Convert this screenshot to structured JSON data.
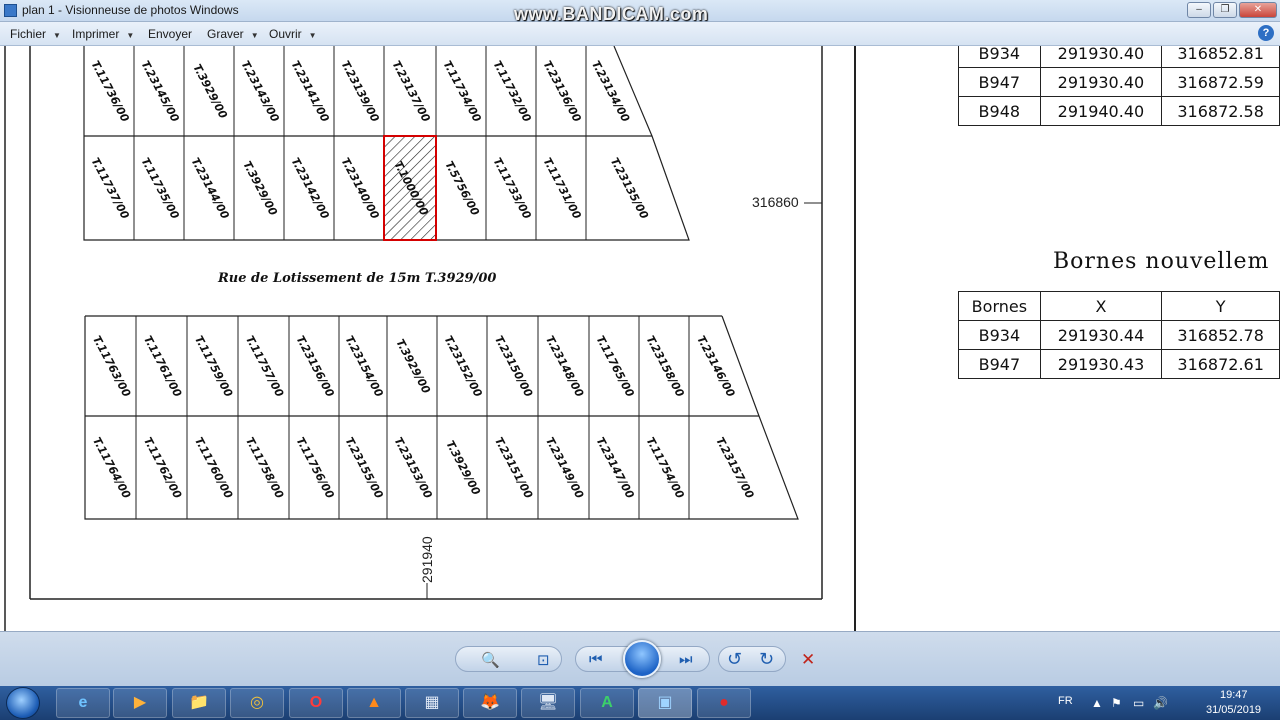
{
  "window": {
    "title": "plan 1 - Visionneuse de photos Windows",
    "watermark": "www.BANDICAM.com",
    "buttons": [
      "–",
      "❐",
      "✕"
    ]
  },
  "menu": [
    "Fichier",
    "Imprimer",
    "Envoyer",
    "Graver",
    "Ouvrir"
  ],
  "help_label": "?",
  "plan": {
    "block1_top_row": [
      "T.11736/00",
      "T.23145/00",
      "T.3929/00",
      "T.23143/00",
      "T.23141/00",
      "T.23139/00",
      "T.23137/00",
      "T.11734/00",
      "T.11732/00",
      "T.23136/00",
      "T.23134/00"
    ],
    "block1_bottom_row": [
      "T.11737/00",
      "T.11735/00",
      "T.23144/00",
      "T.3929/00",
      "T.23142/00",
      "T.23140/00",
      "T.1000/00",
      "T.5756/00",
      "T.11733/00",
      "T.11731/00",
      "T.23135/00"
    ],
    "street": "Rue de Lotissement de 15m T.3929/00",
    "block2_top_row": [
      "T.11763/00",
      "T.11761/00",
      "T.11759/00",
      "T.11757/00",
      "T.23156/00",
      "T.23154/00",
      "T.3929/00",
      "T.23152/00",
      "T.23150/00",
      "T.23148/00",
      "T.11765/00",
      "T.23158/00",
      "T.23146/00"
    ],
    "block2_bottom_row": [
      "T.11764/00",
      "T.11762/00",
      "T.11760/00",
      "T.11758/00",
      "T.11756/00",
      "T.23155/00",
      "T.23153/00",
      "T.3929/00",
      "T.23151/00",
      "T.23149/00",
      "T.23147/00",
      "T.11754/00",
      "T.23157/00"
    ],
    "coord_y_label": "316860",
    "coord_x_label": "291940"
  },
  "table_old": {
    "rows": [
      [
        "B934",
        "291930.40",
        "316852.81"
      ],
      [
        "B947",
        "291930.40",
        "316872.59"
      ],
      [
        "B948",
        "291940.40",
        "316872.58"
      ]
    ]
  },
  "bornes_heading": "Bornes nouvellem",
  "table_new": {
    "headers": [
      "Bornes",
      "X",
      "Y"
    ],
    "rows": [
      [
        "B934",
        "291930.44",
        "316852.78"
      ],
      [
        "B947",
        "291930.43",
        "316872.61"
      ]
    ]
  },
  "toolbar": {
    "zoom": "🔍",
    "fit": "⊡",
    "prev": "⏮",
    "next": "⏭",
    "rotate_left": "↺",
    "rotate_right": "↻",
    "delete": "✕"
  },
  "taskbar": {
    "apps": [
      "e",
      "▶",
      "📁",
      "◎",
      "O",
      "▲",
      "▦",
      "🦊",
      "🖥",
      "A",
      "▣",
      "●"
    ],
    "lang": "FR",
    "tray_icons": [
      "▲",
      "⚑",
      "▭",
      "🔊"
    ],
    "time": "19:47",
    "date": "31/05/2019"
  },
  "colors": {
    "highlight_parcel": "#d40000",
    "accent": "#1f5eb0"
  }
}
